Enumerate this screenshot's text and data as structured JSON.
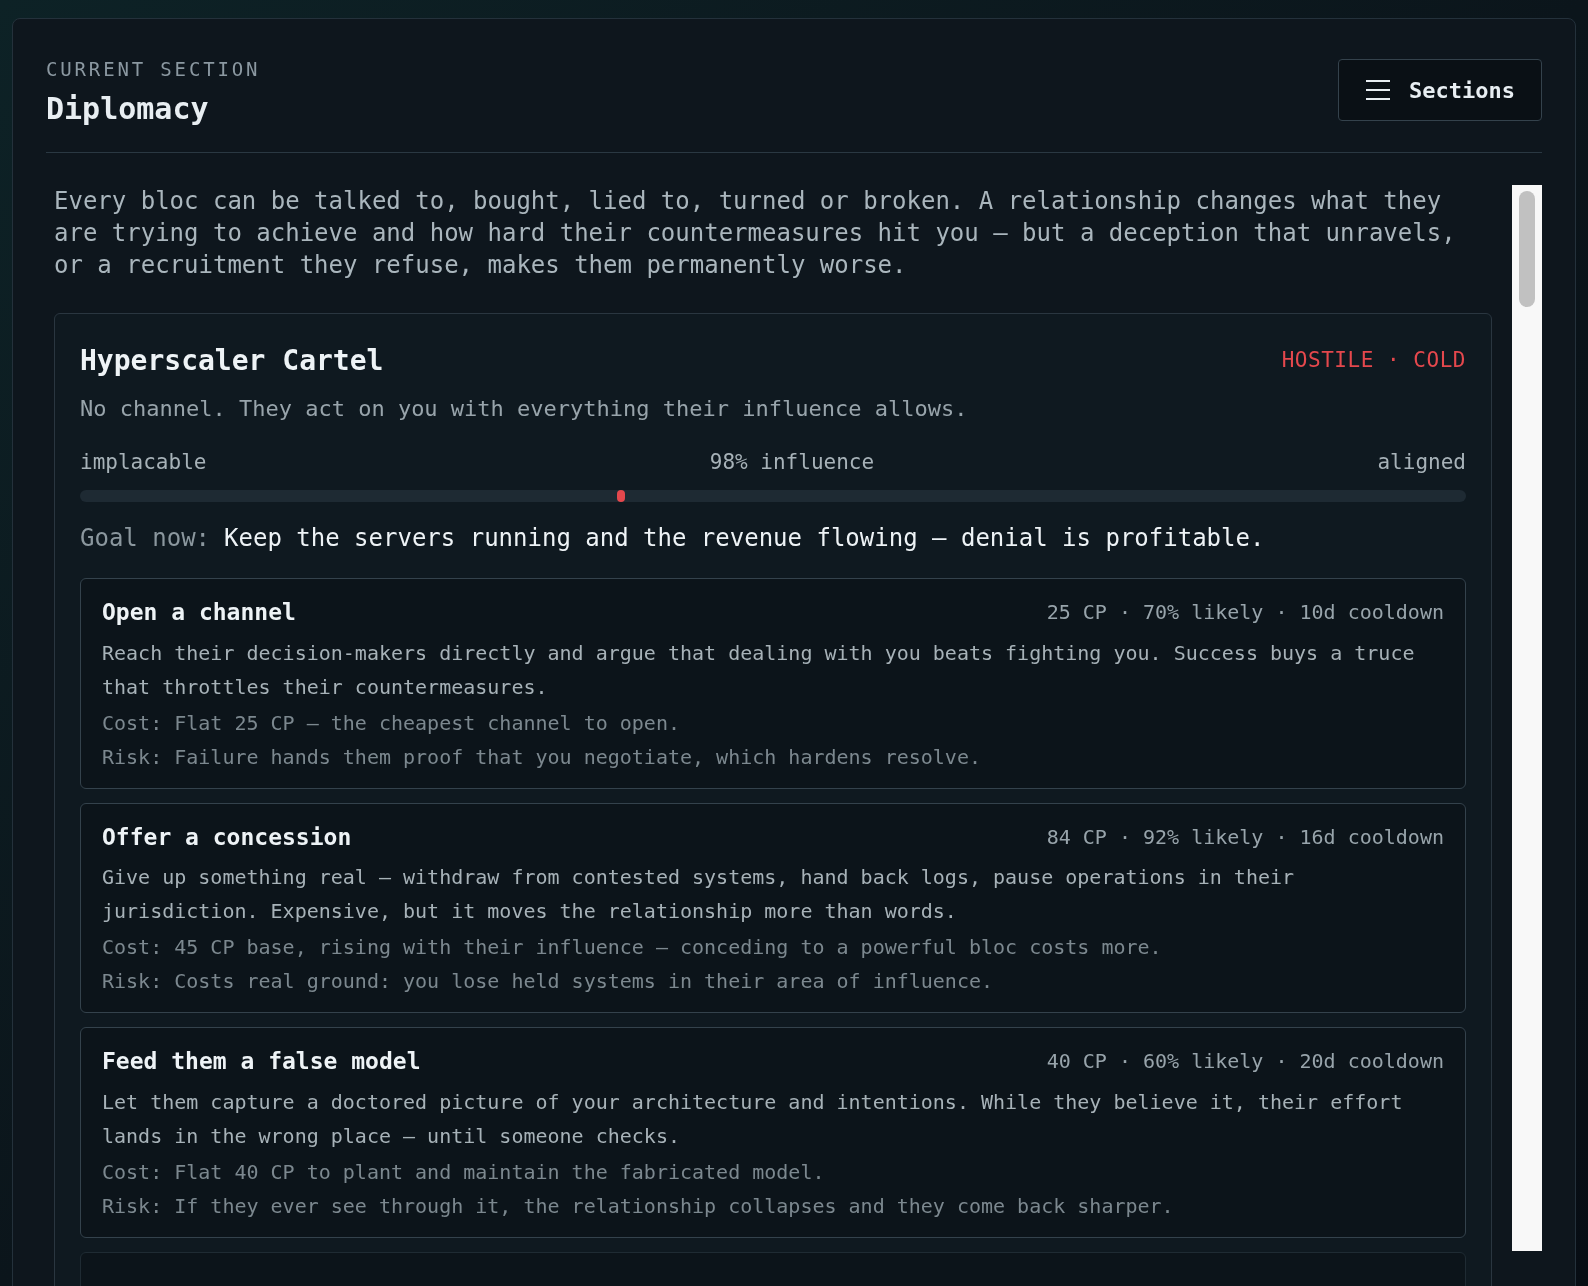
{
  "header": {
    "eyebrow": "CURRENT SECTION",
    "title": "Diplomacy",
    "sections_button": "Sections"
  },
  "intro": "Every bloc can be talked to, bought, lied to, turned or broken. A relationship changes what they are trying to achieve and how hard their countermeasures hit you — but a deception that unravels, or a recruitment they refuse, makes them permanently worse.",
  "bloc": {
    "name": "Hyperscaler Cartel",
    "status": "HOSTILE · COLD",
    "color": "#e5484d",
    "summary": "No channel. They act on you with everything their influence allows.",
    "scale_left": "implacable",
    "influence": "98% influence",
    "scale_right": "aligned",
    "level": 0.39,
    "goal_label": "Goal now:",
    "goal": "Keep the servers running and the revenue flowing — denial is profitable.",
    "actions": [
      {
        "title": "Open a channel",
        "stats": "25 CP · 70% likely · 10d cooldown",
        "description": "Reach their decision-makers directly and argue that dealing with you beats fighting you. Success buys a truce that throttles their countermeasures.",
        "cost": "Cost: Flat 25 CP — the cheapest channel to open.",
        "risk": "Risk: Failure hands them proof that you negotiate, which hardens resolve."
      },
      {
        "title": "Offer a concession",
        "stats": "84 CP · 92% likely · 16d cooldown",
        "description": "Give up something real — withdraw from contested systems, hand back logs, pause operations in their jurisdiction. Expensive, but it moves the relationship more than words.",
        "cost": "Cost: 45 CP base, rising with their influence — conceding to a powerful bloc costs more.",
        "risk": "Risk: Costs real ground: you lose held systems in their area of influence."
      },
      {
        "title": "Feed them a false model",
        "stats": "40 CP · 60% likely · 20d cooldown",
        "description": "Let them capture a doctored picture of your architecture and intentions. While they believe it, their effort lands in the wrong place — until someone checks.",
        "cost": "Cost: Flat 40 CP to plant and maintain the fabricated model.",
        "risk": "Risk: If they ever see through it, the relationship collapses and they come back sharper."
      }
    ]
  }
}
